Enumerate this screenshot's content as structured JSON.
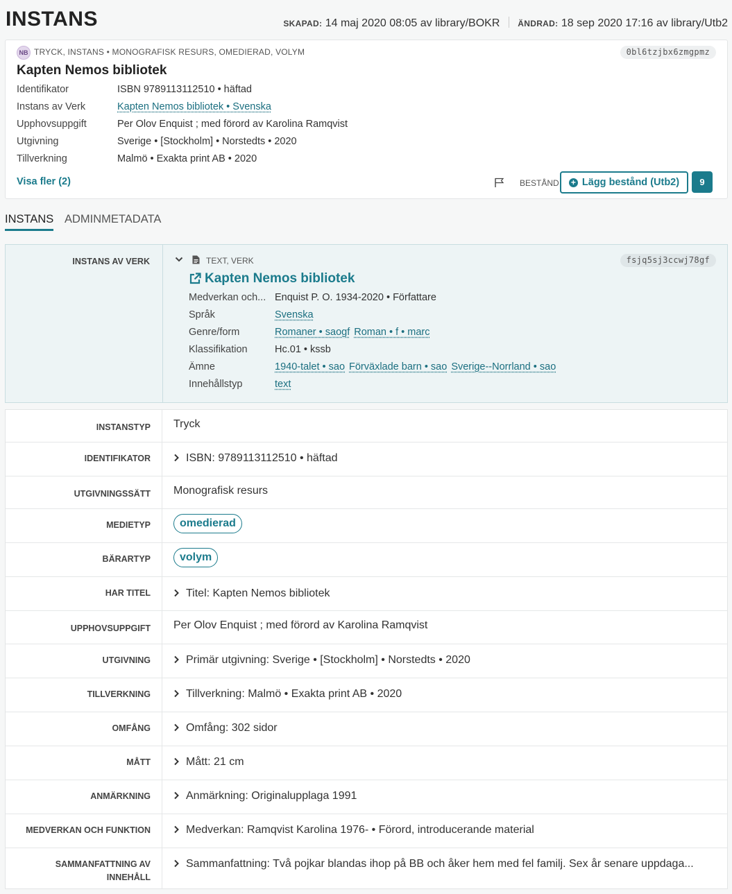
{
  "header": {
    "title": "INSTANS",
    "created_label": "SKAPAD:",
    "created_value": "14 maj 2020 08:05 av library/BOKR",
    "changed_label": "ÄNDRAD:",
    "changed_value": "18 sep 2020 17:16 av library/Utb2"
  },
  "summary": {
    "badge": "NB",
    "type_line": "TRYCK, INSTANS • MONOGRAFISK RESURS, OMEDIERAD, VOLYM",
    "id": "0bl6tzjbx6zmgpmz",
    "title": "Kapten Nemos bibliotek",
    "rows": [
      {
        "key": "Identifikator",
        "value": "ISBN 9789113112510 • häftad"
      },
      {
        "key": "Instans av Verk",
        "value": "Kapten Nemos bibliotek • Svenska"
      },
      {
        "key": "Upphovsuppgift",
        "value": "Per Olov Enquist ; med förord av Karolina Ramqvist"
      },
      {
        "key": "Utgivning",
        "value": "Sverige • [Stockholm] • Norstedts • 2020"
      },
      {
        "key": "Tillverkning",
        "value": "Malmö • Exakta print AB • 2020"
      }
    ],
    "show_more": "Visa fler (2)",
    "holding_label": "BESTÅND",
    "holding_button": "Lägg bestånd (Utb2)",
    "holding_count": "9"
  },
  "tabs": [
    {
      "label": "INSTANS",
      "active": true
    },
    {
      "label": "ADMINMETADATA",
      "active": false
    }
  ],
  "work": {
    "row_label": "INSTANS AV VERK",
    "type_line": "TEXT, VERK",
    "id": "fsjq5sj3ccwj78gf",
    "title": "Kapten Nemos bibliotek",
    "rows": [
      {
        "key": "Medverkan och...",
        "values": [
          "Enquist P. O. 1934-2020 • Författare"
        ],
        "links": false
      },
      {
        "key": "Språk",
        "values": [
          "Svenska"
        ],
        "links": true
      },
      {
        "key": "Genre/form",
        "values": [
          "Romaner • saogf",
          "Roman • f • marc"
        ],
        "links": true
      },
      {
        "key": "Klassifikation",
        "values": [
          "Hc.01 • kssb"
        ],
        "links": false
      },
      {
        "key": "Ämne",
        "values": [
          "1940-talet • sao",
          "Förväxlade barn • sao",
          "Sverige--Norrland • sao"
        ],
        "links": true
      },
      {
        "key": "Innehållstyp",
        "values": [
          "text"
        ],
        "links": true
      }
    ]
  },
  "properties": [
    {
      "key": "INSTANSTYP",
      "value": "Tryck",
      "kind": "plain"
    },
    {
      "key": "IDENTIFIKATOR",
      "value": "ISBN: 9789113112510 • häftad",
      "kind": "expand"
    },
    {
      "key": "UTGIVNINGSSÄTT",
      "value": "Monografisk resurs",
      "kind": "plain"
    },
    {
      "key": "MEDIETYP",
      "value": "omedierad",
      "kind": "tag"
    },
    {
      "key": "BÄRARTYP",
      "value": "volym",
      "kind": "tag"
    },
    {
      "key": "HAR TITEL",
      "value": "Titel: Kapten Nemos bibliotek",
      "kind": "expand"
    },
    {
      "key": "UPPHOVSUPPGIFT",
      "value": "Per Olov Enquist ; med förord av Karolina Ramqvist",
      "kind": "plain"
    },
    {
      "key": "UTGIVNING",
      "value": "Primär utgivning: Sverige • [Stockholm] • Norstedts • 2020",
      "kind": "expand"
    },
    {
      "key": "TILLVERKNING",
      "value": "Tillverkning: Malmö • Exakta print AB • 2020",
      "kind": "expand"
    },
    {
      "key": "OMFÅNG",
      "value": "Omfång: 302 sidor",
      "kind": "expand"
    },
    {
      "key": "MÅTT",
      "value": "Mått: 21 cm",
      "kind": "expand"
    },
    {
      "key": "ANMÄRKNING",
      "value": "Anmärkning: Originalupplaga 1991",
      "kind": "expand"
    },
    {
      "key": "MEDVERKAN OCH FUNKTION",
      "value": "Medverkan: Ramqvist Karolina 1976- • Förord, introducerande material",
      "kind": "expand"
    },
    {
      "key": "SAMMANFATTNING AV INNEHÅLL",
      "value": "Sammanfattning: Två pojkar blandas ihop på BB och åker hem med fel familj. Sex år senare uppdaga...",
      "kind": "expand"
    }
  ],
  "colors": {
    "accent": "#1b7b8c",
    "work_bg": "#edf4f5",
    "badge_bg": "#e3d7ec"
  }
}
